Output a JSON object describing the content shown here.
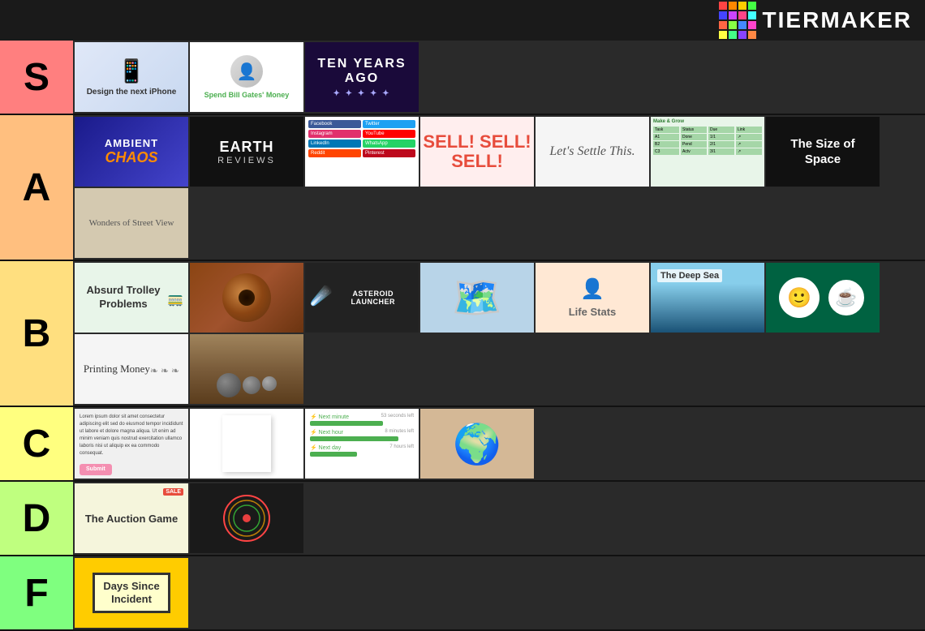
{
  "header": {
    "logo_text": "TIERMAKER",
    "logo_colors": [
      "#ff4444",
      "#ff8800",
      "#ffcc00",
      "#44ff44",
      "#4444ff",
      "#cc44ff",
      "#ff4488",
      "#44ffff",
      "#ff6644",
      "#88ff44",
      "#4488ff",
      "#ff44cc",
      "#ffff44",
      "#44ff88",
      "#8844ff",
      "#ff8844"
    ]
  },
  "tiers": [
    {
      "label": "S",
      "color": "#ff7f7f",
      "items": [
        {
          "id": "iphone",
          "label": "Design the next iPhone"
        },
        {
          "id": "billgates",
          "label": "Spend Bill Gates' Money"
        },
        {
          "id": "tenyearsago",
          "label": "TEN YEARS AGO"
        }
      ]
    },
    {
      "label": "A",
      "color": "#ffbf7f",
      "items": [
        {
          "id": "ambientchaos",
          "label": "AMBIENT CHAOS"
        },
        {
          "id": "earthreviews",
          "label": "EARTH REVIEWS"
        },
        {
          "id": "sharelinks",
          "label": "Share Links"
        },
        {
          "id": "sell",
          "label": "SELL! SELL! SELL!"
        },
        {
          "id": "settlethis",
          "label": "Let's Settle This."
        },
        {
          "id": "spreadsheet",
          "label": "Spreadsheet"
        },
        {
          "id": "sizeofspace",
          "label": "The Size of Space"
        },
        {
          "id": "streetview",
          "label": "Wonders of Street View"
        }
      ]
    },
    {
      "label": "B",
      "color": "#ffdf7f",
      "items": [
        {
          "id": "absurdtrolley",
          "label": "Absurd Trolley Problems"
        },
        {
          "id": "eyeball",
          "label": "Eyeball"
        },
        {
          "id": "asteroid",
          "label": "ASTEROID LAUNCHER"
        },
        {
          "id": "worldmap",
          "label": "World Map"
        },
        {
          "id": "lifestats",
          "label": "Life Stats"
        },
        {
          "id": "deepsea",
          "label": "The Deep Sea"
        },
        {
          "id": "starbucks",
          "label": "Starbucks"
        },
        {
          "id": "printingmoney",
          "label": "Printing Money"
        },
        {
          "id": "stones",
          "label": "Stones"
        }
      ]
    },
    {
      "label": "C",
      "color": "#ffff7f",
      "items": [
        {
          "id": "article",
          "label": "Article"
        },
        {
          "id": "whitepage",
          "label": "White Page"
        },
        {
          "id": "nextminute",
          "label": "Next Minute"
        },
        {
          "id": "worldregions",
          "label": "World Regions Map"
        }
      ]
    },
    {
      "label": "D",
      "color": "#bfff7f",
      "items": [
        {
          "id": "auctiongame",
          "label": "The Auction Game"
        },
        {
          "id": "perfectcircle",
          "label": "Perfect Circle"
        }
      ]
    },
    {
      "label": "F",
      "color": "#7fff7f",
      "items": [
        {
          "id": "dayssince",
          "label": "Days Since Incident"
        }
      ]
    }
  ],
  "progress_bars": [
    {
      "label": "Next minute",
      "width": "70%",
      "info": "53 seconds left"
    },
    {
      "label": "Next hour",
      "width": "85%",
      "info": "8 minutes left"
    },
    {
      "label": "Next day",
      "width": "45%",
      "info": "7 hours left"
    }
  ]
}
